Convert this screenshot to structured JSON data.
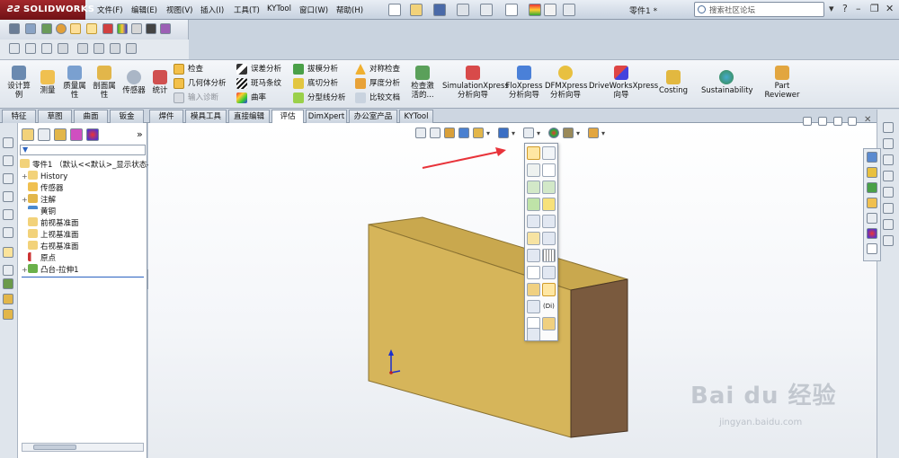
{
  "app": {
    "logo": "SOLIDWORKS",
    "title": "零件1 *"
  },
  "menu": [
    "文件(F)",
    "编辑(E)",
    "视图(V)",
    "插入(I)",
    "工具(T)",
    "KYTool",
    "窗口(W)",
    "帮助(H)"
  ],
  "search": {
    "placeholder": "搜索社区论坛"
  },
  "ribbon": {
    "large": [
      {
        "label": "设计算\n例"
      },
      {
        "label": "测量"
      },
      {
        "label": "质量属\n性"
      },
      {
        "label": "剖面属\n性"
      },
      {
        "label": "传感器"
      },
      {
        "label": "统计"
      }
    ],
    "check_group": [
      "检查",
      "几何体分析",
      "输入诊断"
    ],
    "analysis_group1": [
      "误差分析",
      "斑马条纹",
      "曲率"
    ],
    "analysis_group2": [
      "拔模分析",
      "底切分析",
      "分型线分析"
    ],
    "analysis_group3": [
      "对称检查",
      "厚度分析",
      "比较文档"
    ],
    "check_active": "检查激\n活的...",
    "xpress": [
      {
        "label": "SimulationXpress\n分析向导"
      },
      {
        "label": "FloXpress\n分析向导"
      },
      {
        "label": "DFMXpress\n分析向导"
      },
      {
        "label": "DriveWorksXpress\n向导"
      },
      {
        "label": "Costing"
      },
      {
        "label": "Sustainability"
      },
      {
        "label": "Part\nReviewer"
      }
    ]
  },
  "tabs": [
    {
      "label": "特征"
    },
    {
      "label": "草图"
    },
    {
      "label": "曲面"
    },
    {
      "label": "钣金"
    },
    {
      "label": "焊件"
    },
    {
      "label": "模具工具"
    },
    {
      "label": "直接编辑"
    },
    {
      "label": "评估",
      "active": true
    },
    {
      "label": "DimXpert"
    },
    {
      "label": "办公室产品"
    },
    {
      "label": "KYTool"
    }
  ],
  "tree": {
    "root": "零件1 （默认<<默认>_显示状态-",
    "items": [
      "History",
      "传感器",
      "注解",
      "黄铜",
      "前视基准面",
      "上视基准面",
      "右视基准面",
      "原点",
      "凸台-拉伸1"
    ]
  },
  "popup": {
    "di_label": "(Di)"
  },
  "watermark": {
    "brand": "Bai du 经验",
    "url": "jingyan.baidu.com"
  },
  "colors": {
    "part_front": "#d6b55a",
    "part_top": "#c9a84e",
    "part_side": "#7a5a3e",
    "arrow": "#e8333a",
    "title_accent": "#8b1a1f"
  }
}
